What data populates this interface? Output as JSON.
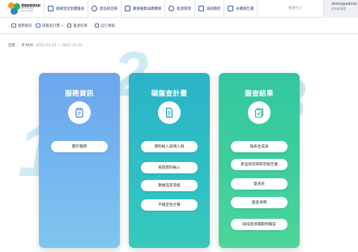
{
  "logo": {
    "line1": "實踐碳管理系統",
    "line2": "CO2 Carbon Accounting"
  },
  "topnav": [
    {
      "label": "組織溫室氣體盤查",
      "icon": "building-icon"
    },
    {
      "label": "產品碳足跡",
      "icon": "footprint-icon"
    },
    {
      "label": "數據蒐集與機構庫",
      "icon": "database-icon"
    },
    {
      "label": "能源管理",
      "icon": "energy-icon"
    },
    {
      "label": "減碳路徑",
      "icon": "path-icon"
    },
    {
      "label": "永續報告書",
      "icon": "report-icon"
    }
  ],
  "language": "繁體中文",
  "user": {
    "name": "demo@admin",
    "role": "使用者權限"
  },
  "subnav": [
    {
      "label": "服務資訊",
      "icon": "info-icon"
    },
    {
      "label": "碳盤查計畫",
      "icon": "plan-icon",
      "dropdown": true
    },
    {
      "label": "盤查結果",
      "icon": "result-icon"
    },
    {
      "label": "自行填報",
      "icon": "fill-icon"
    }
  ],
  "breadcrumb": {
    "home": "首頁",
    "current": "IP BOX",
    "date": "2022-01-01 ~ 2022-12-31"
  },
  "bg_numbers": [
    "1",
    "2",
    "3"
  ],
  "cards": [
    {
      "title": "服務資訊",
      "icon": "clipboard-icon",
      "buttons": [
        "關於服務"
      ]
    },
    {
      "title": "碳盤查計畫",
      "icon": "document-icon",
      "buttons": [
        "資料輸入與填入員",
        "排放資料輸入",
        "數據品質等級",
        "不確定性計算"
      ]
    },
    {
      "title": "盤查結果",
      "icon": "checklist-icon",
      "buttons": [
        "報表生成表",
        "產品碳足跡研究報告書",
        "盤查表",
        "盤查清冊",
        "碳排放清冊範例檔案"
      ]
    }
  ],
  "colors": {
    "service_top": "#6ca5ee",
    "plan_top": "#2bb3c8",
    "result_top": "#34c6a0",
    "nav_text": "#2c3e78"
  }
}
